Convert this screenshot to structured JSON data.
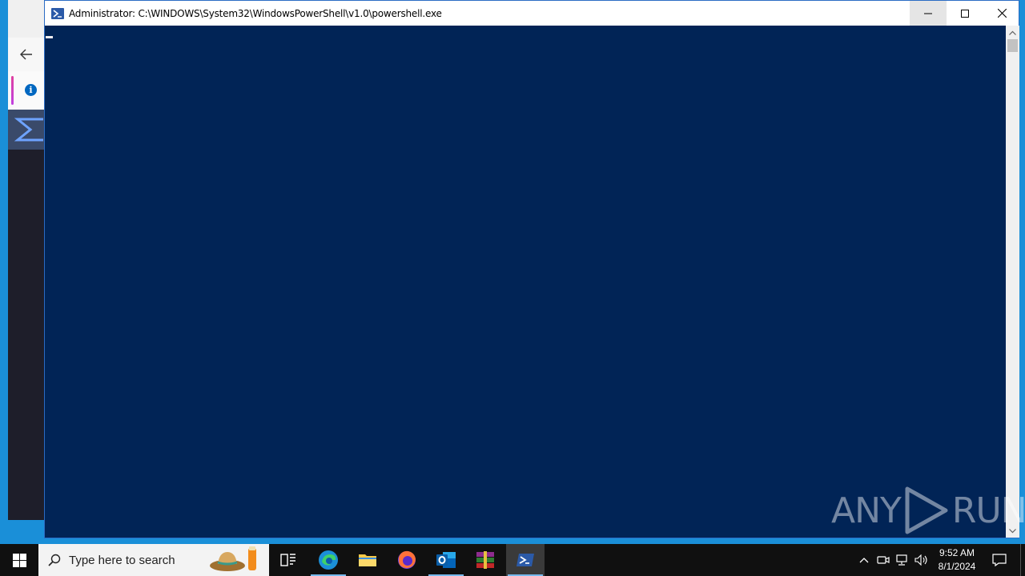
{
  "powershell": {
    "title": "Administrator: C:\\WINDOWS\\System32\\WindowsPowerShell\\v1.0\\powershell.exe",
    "background_color": "#012456",
    "minimize_icon": "minimize-icon",
    "maximize_icon": "maximize-icon",
    "close_icon": "close-icon"
  },
  "background_app": {
    "back_icon": "back-arrow-icon",
    "info_icon": "info-icon",
    "info_glyph": "i",
    "sigma_icon": "sigma-icon"
  },
  "watermark": {
    "left_text": "ANY",
    "right_text": "RUN"
  },
  "taskbar": {
    "search_placeholder": "Type here to search",
    "items": [
      {
        "name": "task-view",
        "icon": "task-view-icon"
      },
      {
        "name": "edge",
        "icon": "edge-icon"
      },
      {
        "name": "file-explorer",
        "icon": "folder-icon"
      },
      {
        "name": "firefox",
        "icon": "firefox-icon"
      },
      {
        "name": "outlook",
        "icon": "outlook-icon"
      },
      {
        "name": "winrar",
        "icon": "winrar-icon"
      },
      {
        "name": "powershell",
        "icon": "powershell-icon"
      }
    ],
    "clock": {
      "time": "9:52 AM",
      "date": "8/1/2024"
    },
    "accent_color": "#76b9ed"
  }
}
